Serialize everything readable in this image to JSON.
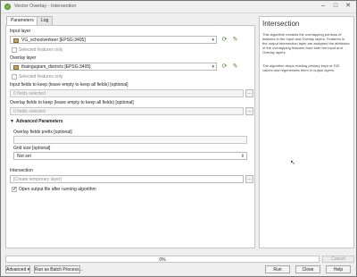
{
  "window": {
    "title": "Vector Overlay - Intersection",
    "minimize": "–",
    "maximize": "□",
    "close": "✕"
  },
  "tabs": [
    "Parameters",
    "Log"
  ],
  "params": {
    "input_layer_label": "Input layer",
    "input_layer_value": "VG_schoolverkeer [EPSG:3405]",
    "input_selected_only": "Selected features only",
    "overlay_layer_label": "Overlay layer",
    "overlay_layer_value": "thaingugiam_districts [EPSG:3405]",
    "overlay_selected_only": "Selected features only",
    "input_fields_label": "Input fields to keep (leave empty to keep all fields) [optional]",
    "input_fields_value": "0 fields selected",
    "overlay_fields_label": "Overlay fields to keep (leave empty to keep all fields) [optional]",
    "overlay_fields_value": "0 fields selected",
    "advanced_section": "Advanced Parameters",
    "overlay_prefix_label": "Overlay fields prefix [optional]",
    "overlay_prefix_value": "",
    "grid_size_label": "Grid size [optional]",
    "grid_size_value": "Not set",
    "intersection_label": "Intersection",
    "intersection_value": "[Create temporary layer]",
    "open_output_label": "Open output file after running algorithm",
    "browse": "…"
  },
  "help": {
    "title": "Intersection",
    "p1": "This algorithm extracts the overlapping portions of features in the Input and Overlay layers. Features in the output Intersection layer are assigned the attributes of the overlapping features from both the Input and Overlay layers.",
    "p2": "The algorithm drops existing primary keys or FID values and regenerates them in output layers."
  },
  "footer": {
    "progress_text": "0%",
    "progress_value": 0,
    "cancel": "Cancel",
    "advanced": "Advanced",
    "advanced_dd": "▾",
    "batch": "Run as Batch Process…",
    "run": "Run",
    "close": "Close",
    "help": "Help"
  }
}
